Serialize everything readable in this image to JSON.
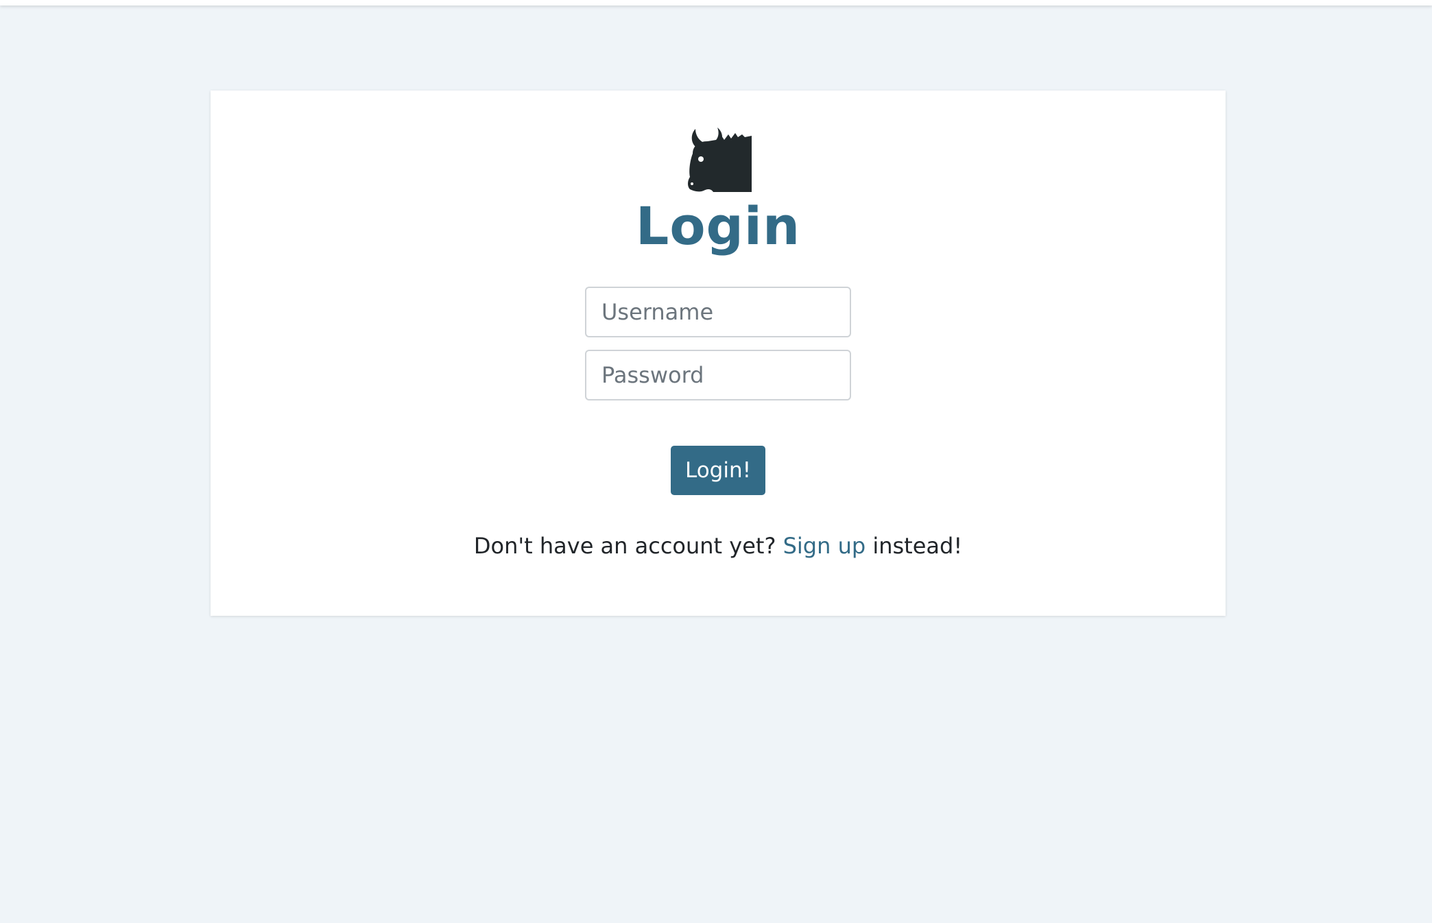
{
  "login": {
    "title": "Login",
    "logo_icon": "bison-icon",
    "username_placeholder": "Username",
    "password_placeholder": "Password",
    "submit_label": "Login!",
    "signup_prompt_before": "Don't have an account yet?",
    "signup_link_label": "Sign up",
    "signup_prompt_after": "instead!"
  },
  "colors": {
    "accent": "#336b87",
    "background": "#eff4f8",
    "text": "#212529",
    "logo": "#22292c"
  }
}
